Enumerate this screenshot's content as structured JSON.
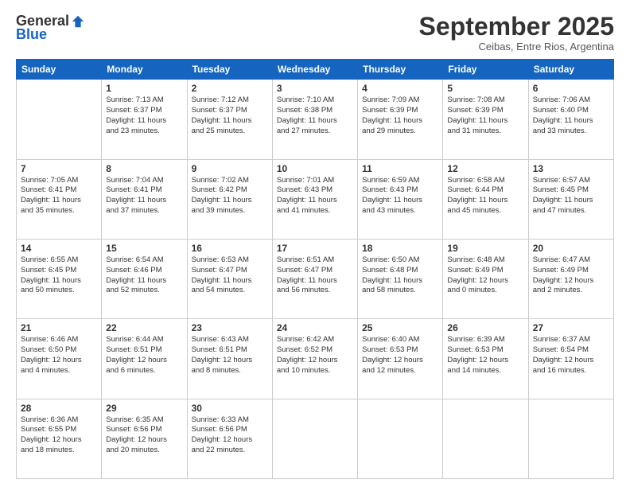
{
  "header": {
    "logo_general": "General",
    "logo_blue": "Blue",
    "month_title": "September 2025",
    "location": "Ceibas, Entre Rios, Argentina"
  },
  "weekdays": [
    "Sunday",
    "Monday",
    "Tuesday",
    "Wednesday",
    "Thursday",
    "Friday",
    "Saturday"
  ],
  "weeks": [
    [
      {
        "day": "",
        "info": ""
      },
      {
        "day": "1",
        "info": "Sunrise: 7:13 AM\nSunset: 6:37 PM\nDaylight: 11 hours\nand 23 minutes."
      },
      {
        "day": "2",
        "info": "Sunrise: 7:12 AM\nSunset: 6:37 PM\nDaylight: 11 hours\nand 25 minutes."
      },
      {
        "day": "3",
        "info": "Sunrise: 7:10 AM\nSunset: 6:38 PM\nDaylight: 11 hours\nand 27 minutes."
      },
      {
        "day": "4",
        "info": "Sunrise: 7:09 AM\nSunset: 6:39 PM\nDaylight: 11 hours\nand 29 minutes."
      },
      {
        "day": "5",
        "info": "Sunrise: 7:08 AM\nSunset: 6:39 PM\nDaylight: 11 hours\nand 31 minutes."
      },
      {
        "day": "6",
        "info": "Sunrise: 7:06 AM\nSunset: 6:40 PM\nDaylight: 11 hours\nand 33 minutes."
      }
    ],
    [
      {
        "day": "7",
        "info": "Sunrise: 7:05 AM\nSunset: 6:41 PM\nDaylight: 11 hours\nand 35 minutes."
      },
      {
        "day": "8",
        "info": "Sunrise: 7:04 AM\nSunset: 6:41 PM\nDaylight: 11 hours\nand 37 minutes."
      },
      {
        "day": "9",
        "info": "Sunrise: 7:02 AM\nSunset: 6:42 PM\nDaylight: 11 hours\nand 39 minutes."
      },
      {
        "day": "10",
        "info": "Sunrise: 7:01 AM\nSunset: 6:43 PM\nDaylight: 11 hours\nand 41 minutes."
      },
      {
        "day": "11",
        "info": "Sunrise: 6:59 AM\nSunset: 6:43 PM\nDaylight: 11 hours\nand 43 minutes."
      },
      {
        "day": "12",
        "info": "Sunrise: 6:58 AM\nSunset: 6:44 PM\nDaylight: 11 hours\nand 45 minutes."
      },
      {
        "day": "13",
        "info": "Sunrise: 6:57 AM\nSunset: 6:45 PM\nDaylight: 11 hours\nand 47 minutes."
      }
    ],
    [
      {
        "day": "14",
        "info": "Sunrise: 6:55 AM\nSunset: 6:45 PM\nDaylight: 11 hours\nand 50 minutes."
      },
      {
        "day": "15",
        "info": "Sunrise: 6:54 AM\nSunset: 6:46 PM\nDaylight: 11 hours\nand 52 minutes."
      },
      {
        "day": "16",
        "info": "Sunrise: 6:53 AM\nSunset: 6:47 PM\nDaylight: 11 hours\nand 54 minutes."
      },
      {
        "day": "17",
        "info": "Sunrise: 6:51 AM\nSunset: 6:47 PM\nDaylight: 11 hours\nand 56 minutes."
      },
      {
        "day": "18",
        "info": "Sunrise: 6:50 AM\nSunset: 6:48 PM\nDaylight: 11 hours\nand 58 minutes."
      },
      {
        "day": "19",
        "info": "Sunrise: 6:48 AM\nSunset: 6:49 PM\nDaylight: 12 hours\nand 0 minutes."
      },
      {
        "day": "20",
        "info": "Sunrise: 6:47 AM\nSunset: 6:49 PM\nDaylight: 12 hours\nand 2 minutes."
      }
    ],
    [
      {
        "day": "21",
        "info": "Sunrise: 6:46 AM\nSunset: 6:50 PM\nDaylight: 12 hours\nand 4 minutes."
      },
      {
        "day": "22",
        "info": "Sunrise: 6:44 AM\nSunset: 6:51 PM\nDaylight: 12 hours\nand 6 minutes."
      },
      {
        "day": "23",
        "info": "Sunrise: 6:43 AM\nSunset: 6:51 PM\nDaylight: 12 hours\nand 8 minutes."
      },
      {
        "day": "24",
        "info": "Sunrise: 6:42 AM\nSunset: 6:52 PM\nDaylight: 12 hours\nand 10 minutes."
      },
      {
        "day": "25",
        "info": "Sunrise: 6:40 AM\nSunset: 6:53 PM\nDaylight: 12 hours\nand 12 minutes."
      },
      {
        "day": "26",
        "info": "Sunrise: 6:39 AM\nSunset: 6:53 PM\nDaylight: 12 hours\nand 14 minutes."
      },
      {
        "day": "27",
        "info": "Sunrise: 6:37 AM\nSunset: 6:54 PM\nDaylight: 12 hours\nand 16 minutes."
      }
    ],
    [
      {
        "day": "28",
        "info": "Sunrise: 6:36 AM\nSunset: 6:55 PM\nDaylight: 12 hours\nand 18 minutes."
      },
      {
        "day": "29",
        "info": "Sunrise: 6:35 AM\nSunset: 6:56 PM\nDaylight: 12 hours\nand 20 minutes."
      },
      {
        "day": "30",
        "info": "Sunrise: 6:33 AM\nSunset: 6:56 PM\nDaylight: 12 hours\nand 22 minutes."
      },
      {
        "day": "",
        "info": ""
      },
      {
        "day": "",
        "info": ""
      },
      {
        "day": "",
        "info": ""
      },
      {
        "day": "",
        "info": ""
      }
    ]
  ]
}
